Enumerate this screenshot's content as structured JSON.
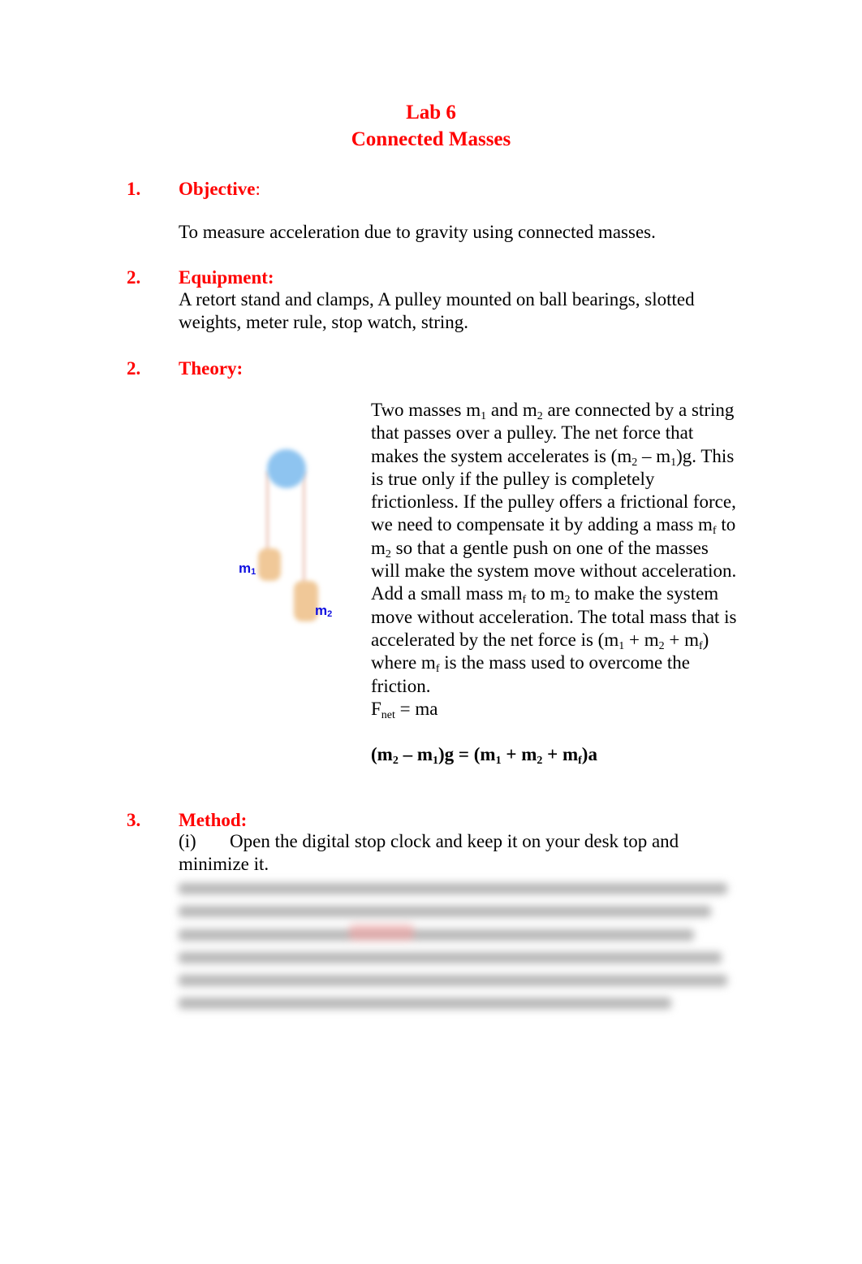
{
  "header": {
    "lab_number": "Lab 6",
    "lab_title": "Connected Masses"
  },
  "sections": {
    "objective": {
      "number": "1.",
      "title": "Objective",
      "colon": ":",
      "text": "To measure acceleration due to gravity using connected masses."
    },
    "equipment": {
      "number": "2.",
      "title": "Equipment:",
      "text_line1": "A retort stand and clamps, A pulley mounted on ball bearings, slotted",
      "text_line2": "weights, meter rule, stop watch, string."
    },
    "theory": {
      "number": "2.",
      "title": "Theory:",
      "diagram": {
        "label_m1": "m",
        "label_m1_sub": "1",
        "label_m2": "m",
        "label_m2_sub": "2",
        "colors": {
          "pulley": "#8ec4f0",
          "mass": "#f0c898",
          "string": "#f3dcd4",
          "label": "#1010e0"
        }
      },
      "p1": {
        "a": "Two masses m",
        "a_sub": "1",
        "b": " and m",
        "b_sub": "2",
        "c": " are connected by a string that passes over a pulley. The net force that makes the system accelerates is (m",
        "c_sub": "2",
        "d": " – m",
        "d_sub": "1",
        "e": ")g. This is true only if the pulley is completely frictionless. If the pulley offers a frictional force, we need to compensate it by adding a mass m",
        "e_sub": "f",
        "f": " to m",
        "f_sub": "2",
        "g": " so that a gentle push on one of the masses will make the system move without acceleration."
      },
      "p2": {
        "a": "Add a small mass m",
        "a_sub": "f",
        "b": " to m",
        "b_sub": "2",
        "c": " to make the system move without acceleration. The  total mass that is accelerated by the net force is (m",
        "c_sub": "1",
        "d": " + m",
        "d_sub": "2",
        "e": " + m",
        "e_sub": "f",
        "f": ") where m",
        "f_sub": "f",
        "g": " is the mass used to overcome the friction."
      },
      "fnet": {
        "a": "F",
        "a_sub": "net",
        "b": " = ma"
      },
      "equation": {
        "p1": "(m",
        "s1": "2",
        "p2": " – m",
        "s2": "1",
        "p3": ")g = (m",
        "s3": "1",
        "p4": " + m",
        "s4": "2",
        "p5": " + m",
        "s5": "f",
        "p6": ")a"
      }
    },
    "method": {
      "number": "3.",
      "title": "Method:",
      "step1_label": "(i)",
      "step1_text": "Open the digital stop clock and keep it on your desk top and",
      "step1_text2": "minimize it."
    }
  },
  "colors": {
    "heading": "#ff0000",
    "body": "#000000"
  }
}
